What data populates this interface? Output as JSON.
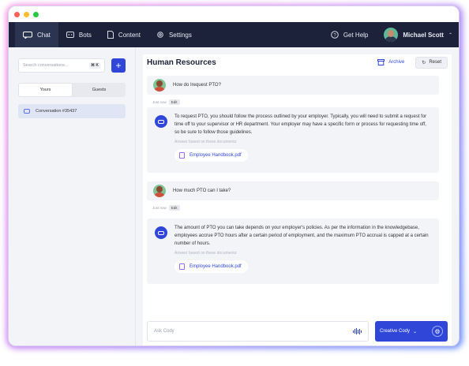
{
  "nav": {
    "chat": "Chat",
    "bots": "Bots",
    "content": "Content",
    "settings": "Settings",
    "help": "Get Help",
    "user": "Michael Scott"
  },
  "sidebar": {
    "search_placeholder": "Search conversations...",
    "shortcut": "⌘ K",
    "tabs": [
      "Yours",
      "Guests"
    ],
    "conversation": "Conversation #35437"
  },
  "main": {
    "title": "Human Resources",
    "archive": "Archive",
    "reset": "Reset"
  },
  "messages": [
    {
      "question": "How do Irequest PTO?",
      "time": "Just now",
      "edit": "Edit",
      "answer": "To request PTO, you should follow the process outlined by your employer. Typically, you will need to submit a request for time off to your supervisor or HR department. Your employer may have a specific form or process for requesting time off, so be sure to follow those guidelines.",
      "source_label": "Answer based on these documents:",
      "source": "Employee Handbook.pdf"
    },
    {
      "question": "How much PTO can I take?",
      "time": "Just now",
      "edit": "Edit",
      "answer": "The amount of PTO you can take depends on your employer's policies. As per the information in the knowledgebase, employees accrue PTO hours after a certain period of employment, and the maximum PTO accrual is capped at a certain number of hours.",
      "source_label": "Answer based on these documents:",
      "source": "Employee Handbook.pdf"
    }
  ],
  "composer": {
    "placeholder": "Ask Cody",
    "mode": "Creative Cody"
  },
  "colors": {
    "accent": "#2f46d8",
    "navbar": "#1b2239"
  }
}
